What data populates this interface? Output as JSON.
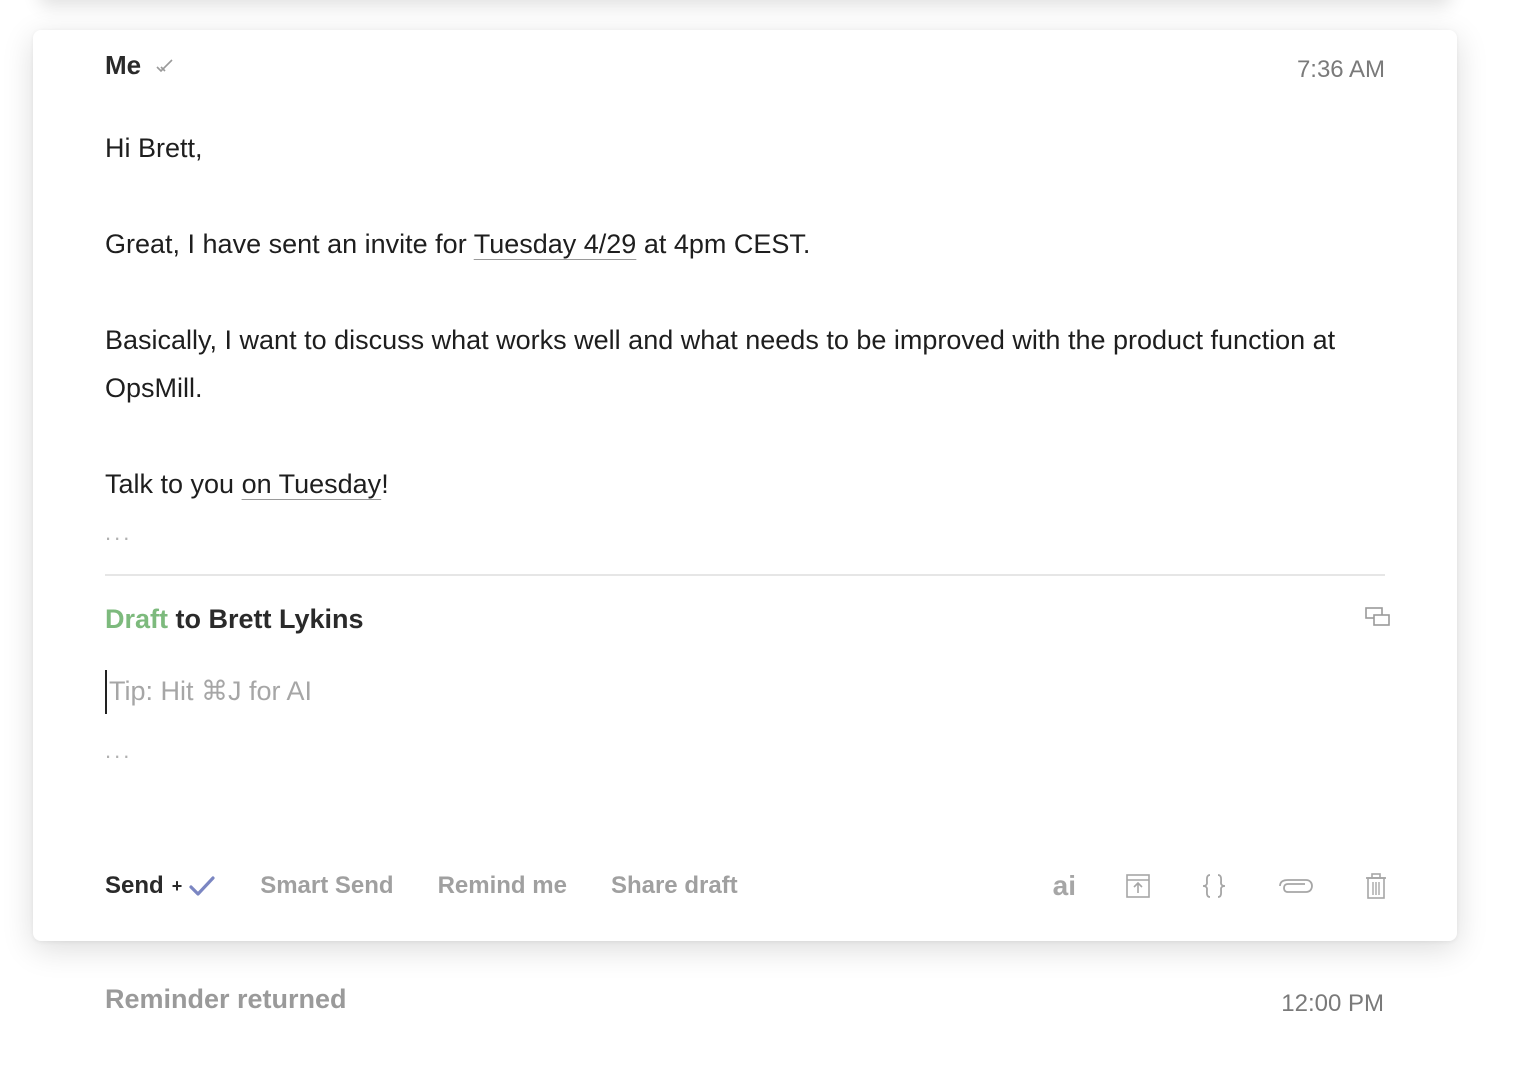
{
  "message": {
    "sender": "Me",
    "time": "7:36 AM",
    "greeting": "Hi Brett,",
    "line1_pre": "Great, I have sent an invite for ",
    "line1_link": "Tuesday 4/29",
    "line1_post": " at 4pm CEST.",
    "line2": "Basically, I want to discuss what works well and what needs to be improved with the product function at OpsMill.",
    "line3_pre": "Talk to you ",
    "line3_link": "on Tuesday",
    "line3_post": "!",
    "ellipsis": "..."
  },
  "draft": {
    "label": "Draft",
    "recipient_text": " to Brett Lykins",
    "placeholder": "Tip: Hit ⌘J for AI",
    "ellipsis": "..."
  },
  "toolbar": {
    "send": "Send",
    "send_plus": "+",
    "smart_send": "Smart Send",
    "remind_me": "Remind me",
    "share_draft": "Share draft",
    "ai": "ai"
  },
  "reminder": {
    "label": "Reminder returned",
    "time": "12:00 PM"
  },
  "colors": {
    "draft_green": "#7dba7d",
    "send_check": "#7b86c2",
    "muted": "#a0a0a0"
  }
}
